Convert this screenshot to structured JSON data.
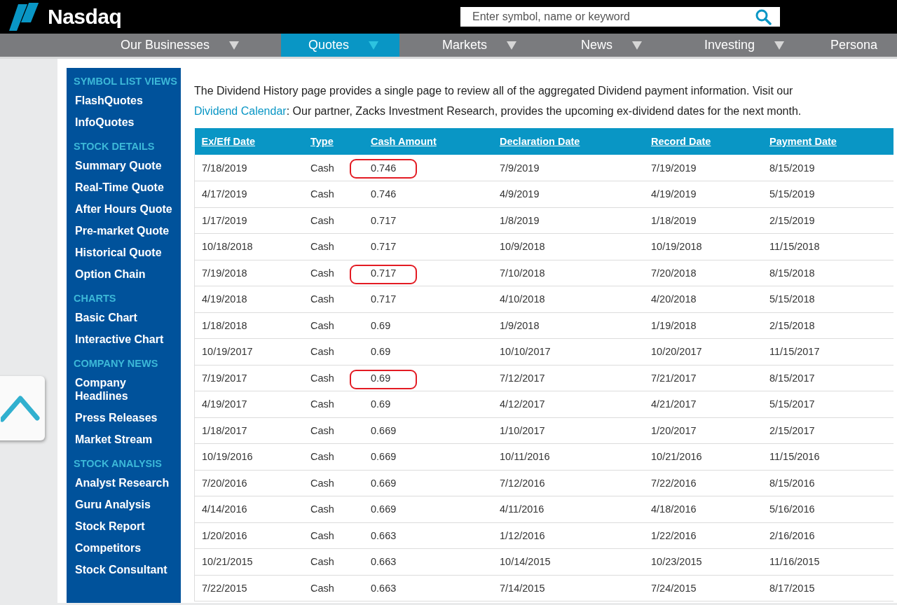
{
  "header": {
    "logo": "Nasdaq",
    "search": {
      "placeholder": "Enter symbol, name or keyword"
    }
  },
  "nav": [
    {
      "label": "Our Businesses",
      "selected": false
    },
    {
      "label": "Quotes",
      "selected": true
    },
    {
      "label": "Markets",
      "selected": false
    },
    {
      "label": "News",
      "selected": false
    },
    {
      "label": "Investing",
      "selected": false
    },
    {
      "label": "Persona",
      "selected": false
    }
  ],
  "sidebar": [
    {
      "kind": "heading",
      "label": "SYMBOL LIST VIEWS"
    },
    {
      "kind": "link",
      "label": "FlashQuotes"
    },
    {
      "kind": "link",
      "label": "InfoQuotes"
    },
    {
      "kind": "heading",
      "label": "STOCK DETAILS"
    },
    {
      "kind": "link",
      "label": "Summary Quote"
    },
    {
      "kind": "link",
      "label": "Real-Time Quote"
    },
    {
      "kind": "link",
      "label": "After Hours Quote"
    },
    {
      "kind": "link",
      "label": "Pre-market Quote"
    },
    {
      "kind": "link",
      "label": "Historical Quote"
    },
    {
      "kind": "link",
      "label": "Option Chain"
    },
    {
      "kind": "heading",
      "label": "CHARTS"
    },
    {
      "kind": "link",
      "label": "Basic Chart"
    },
    {
      "kind": "link",
      "label": "Interactive Chart"
    },
    {
      "kind": "heading",
      "label": "COMPANY NEWS"
    },
    {
      "kind": "link",
      "label": "Company Headlines"
    },
    {
      "kind": "link",
      "label": "Press Releases"
    },
    {
      "kind": "link",
      "label": "Market Stream"
    },
    {
      "kind": "heading",
      "label": "STOCK ANALYSIS"
    },
    {
      "kind": "link",
      "label": "Analyst Research"
    },
    {
      "kind": "link",
      "label": "Guru Analysis"
    },
    {
      "kind": "link",
      "label": "Stock Report"
    },
    {
      "kind": "link",
      "label": "Competitors"
    },
    {
      "kind": "link",
      "label": "Stock Consultant"
    }
  ],
  "intro": {
    "before": "The Dividend History page provides a single page to review all of the aggregated Dividend payment information. Visit our ",
    "link": "Dividend Calendar",
    "after": ": Our partner, Zacks Investment Research, provides the upcoming ex-dividend dates for the next month."
  },
  "table": {
    "columns": [
      "Ex/Eff Date",
      "Type",
      "Cash Amount",
      "Declaration Date",
      "Record Date",
      "Payment Date"
    ],
    "rows": [
      {
        "cells": [
          "7/18/2019",
          "Cash",
          "0.746",
          "7/9/2019",
          "7/19/2019",
          "8/15/2019"
        ],
        "circled": true
      },
      {
        "cells": [
          "4/17/2019",
          "Cash",
          "0.746",
          "4/9/2019",
          "4/19/2019",
          "5/15/2019"
        ],
        "circled": false
      },
      {
        "cells": [
          "1/17/2019",
          "Cash",
          "0.717",
          "1/8/2019",
          "1/18/2019",
          "2/15/2019"
        ],
        "circled": false
      },
      {
        "cells": [
          "10/18/2018",
          "Cash",
          "0.717",
          "10/9/2018",
          "10/19/2018",
          "11/15/2018"
        ],
        "circled": false
      },
      {
        "cells": [
          "7/19/2018",
          "Cash",
          "0.717",
          "7/10/2018",
          "7/20/2018",
          "8/15/2018"
        ],
        "circled": true
      },
      {
        "cells": [
          "4/19/2018",
          "Cash",
          "0.717",
          "4/10/2018",
          "4/20/2018",
          "5/15/2018"
        ],
        "circled": false
      },
      {
        "cells": [
          "1/18/2018",
          "Cash",
          "0.69",
          "1/9/2018",
          "1/19/2018",
          "2/15/2018"
        ],
        "circled": false
      },
      {
        "cells": [
          "10/19/2017",
          "Cash",
          "0.69",
          "10/10/2017",
          "10/20/2017",
          "11/15/2017"
        ],
        "circled": false
      },
      {
        "cells": [
          "7/19/2017",
          "Cash",
          "0.69",
          "7/12/2017",
          "7/21/2017",
          "8/15/2017"
        ],
        "circled": true
      },
      {
        "cells": [
          "4/19/2017",
          "Cash",
          "0.69",
          "4/12/2017",
          "4/21/2017",
          "5/15/2017"
        ],
        "circled": false
      },
      {
        "cells": [
          "1/18/2017",
          "Cash",
          "0.669",
          "1/10/2017",
          "1/20/2017",
          "2/15/2017"
        ],
        "circled": false
      },
      {
        "cells": [
          "10/19/2016",
          "Cash",
          "0.669",
          "10/11/2016",
          "10/21/2016",
          "11/15/2016"
        ],
        "circled": false
      },
      {
        "cells": [
          "7/20/2016",
          "Cash",
          "0.669",
          "7/12/2016",
          "7/22/2016",
          "8/15/2016"
        ],
        "circled": false
      },
      {
        "cells": [
          "4/14/2016",
          "Cash",
          "0.669",
          "4/11/2016",
          "4/18/2016",
          "5/16/2016"
        ],
        "circled": false
      },
      {
        "cells": [
          "1/20/2016",
          "Cash",
          "0.663",
          "1/12/2016",
          "1/22/2016",
          "2/16/2016"
        ],
        "circled": false
      },
      {
        "cells": [
          "10/21/2015",
          "Cash",
          "0.663",
          "10/14/2015",
          "10/23/2015",
          "11/16/2015"
        ],
        "circled": false
      },
      {
        "cells": [
          "7/22/2015",
          "Cash",
          "0.663",
          "7/14/2015",
          "7/24/2015",
          "8/17/2015"
        ],
        "circled": false
      }
    ]
  }
}
